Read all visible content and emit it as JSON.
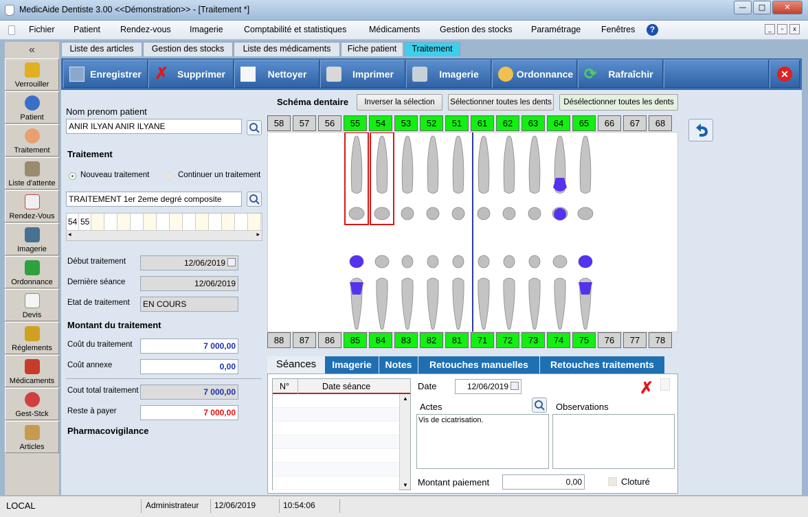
{
  "window": {
    "title": "MedicAide Dentiste 3.00 <<Démonstration>>  - [Traitement *]",
    "min": "—",
    "max": "□",
    "close": "✕"
  },
  "menu": {
    "items": [
      "Fichier",
      "Patient",
      "Rendez-vous",
      "Imagerie",
      "Comptabilité et statistiques",
      "Médicaments",
      "Gestion des stocks",
      "Paramétrage",
      "Fenêtres"
    ],
    "help": "?"
  },
  "sidebar": {
    "collapse": "«",
    "items": [
      "Verrouiller",
      "Patient",
      "Traitement",
      "Liste d'attente",
      "Rendez-Vous",
      "Imagerie",
      "Ordonnance",
      "Devis",
      "Réglements",
      "Médicaments",
      "Gest-Stck",
      "Articles"
    ]
  },
  "tabs": [
    "Liste des articles",
    "Gestion des stocks",
    "Liste des médicaments",
    "Fiche patient",
    "Traitement"
  ],
  "toolbar": {
    "save": "Enregistrer",
    "delete": "Supprimer",
    "clean": "Nettoyer",
    "print": "Imprimer",
    "imaging": "Imagerie",
    "prescription": "Ordonnance",
    "refresh": "Rafraîchir"
  },
  "form": {
    "patient_label": "Nom prenom patient",
    "patient_value": "ANIR ILYAN  ANIR ILYANE",
    "treatment_heading": "Traitement",
    "radio_new": "Nouveau traitement",
    "radio_continue": "Continuer un traitement",
    "treatment_value": "TRAITEMENT 1er 2eme degré  composite",
    "teeth_cells": [
      "54",
      "55",
      "",
      "",
      "",
      "",
      "",
      "",
      "",
      "",
      "",
      "",
      "",
      "",
      ""
    ],
    "start_label": "Début traitement",
    "start_value": "12/06/2019",
    "last_label": "Dernière séance",
    "last_value": "12/06/2019",
    "state_label": "Etat de traitement",
    "state_value": "EN COURS",
    "amount_heading": "Montant du traitement",
    "cost_label": "Coût du traitement",
    "cost_value": "7 000,00",
    "annex_label": "Coût annexe",
    "annex_value": "0,00",
    "total_label": "Cout total traitement",
    "total_value": "7 000,00",
    "rest_label": "Reste à payer",
    "rest_value": "7 000,00",
    "pharma_heading": "Pharmacovigilance"
  },
  "schema": {
    "title": "Schéma dentaire",
    "invert": "Inverser la sélection",
    "select_all": "Sélectionner toutes les dents",
    "deselect_all": "Désélectionner toutes les dents",
    "upper": [
      {
        "n": "58",
        "s": 0
      },
      {
        "n": "57",
        "s": 0
      },
      {
        "n": "56",
        "s": 0
      },
      {
        "n": "55",
        "s": 1
      },
      {
        "n": "54",
        "s": 1
      },
      {
        "n": "53",
        "s": 1
      },
      {
        "n": "52",
        "s": 1
      },
      {
        "n": "51",
        "s": 1
      },
      {
        "n": "61",
        "s": 1
      },
      {
        "n": "62",
        "s": 1
      },
      {
        "n": "63",
        "s": 1
      },
      {
        "n": "64",
        "s": 1
      },
      {
        "n": "65",
        "s": 1
      },
      {
        "n": "66",
        "s": 0
      },
      {
        "n": "67",
        "s": 0
      },
      {
        "n": "68",
        "s": 0
      }
    ],
    "lower": [
      {
        "n": "88",
        "s": 0
      },
      {
        "n": "87",
        "s": 0
      },
      {
        "n": "86",
        "s": 0
      },
      {
        "n": "85",
        "s": 1
      },
      {
        "n": "84",
        "s": 1
      },
      {
        "n": "83",
        "s": 1
      },
      {
        "n": "82",
        "s": 1
      },
      {
        "n": "81",
        "s": 1
      },
      {
        "n": "71",
        "s": 1
      },
      {
        "n": "72",
        "s": 1
      },
      {
        "n": "73",
        "s": 1
      },
      {
        "n": "74",
        "s": 1
      },
      {
        "n": "75",
        "s": 1
      },
      {
        "n": "76",
        "s": 0
      },
      {
        "n": "77",
        "s": 0
      },
      {
        "n": "78",
        "s": 0
      }
    ],
    "colors": {
      "selected": "#12f012",
      "unselected": "#d3d3d3",
      "marked": "#5533ee",
      "frame": "#d81818"
    }
  },
  "bottom_tabs": [
    "Séances",
    "Imagerie",
    "Notes",
    "Retouches manuelles",
    "Retouches traitements"
  ],
  "seances": {
    "col_num": "N°",
    "col_date": "Date séance",
    "date_label": "Date",
    "date_value": "12/06/2019",
    "actes_label": "Actes",
    "actes_value": "Vis de cicatrisation.",
    "obs_label": "Observations",
    "pay_label": "Montant paiement",
    "pay_value": "0,00",
    "closed_label": "Cloturé"
  },
  "status": {
    "location": "LOCAL",
    "user": "Administrateur",
    "date": "12/06/2019",
    "time": "10:54:06"
  }
}
